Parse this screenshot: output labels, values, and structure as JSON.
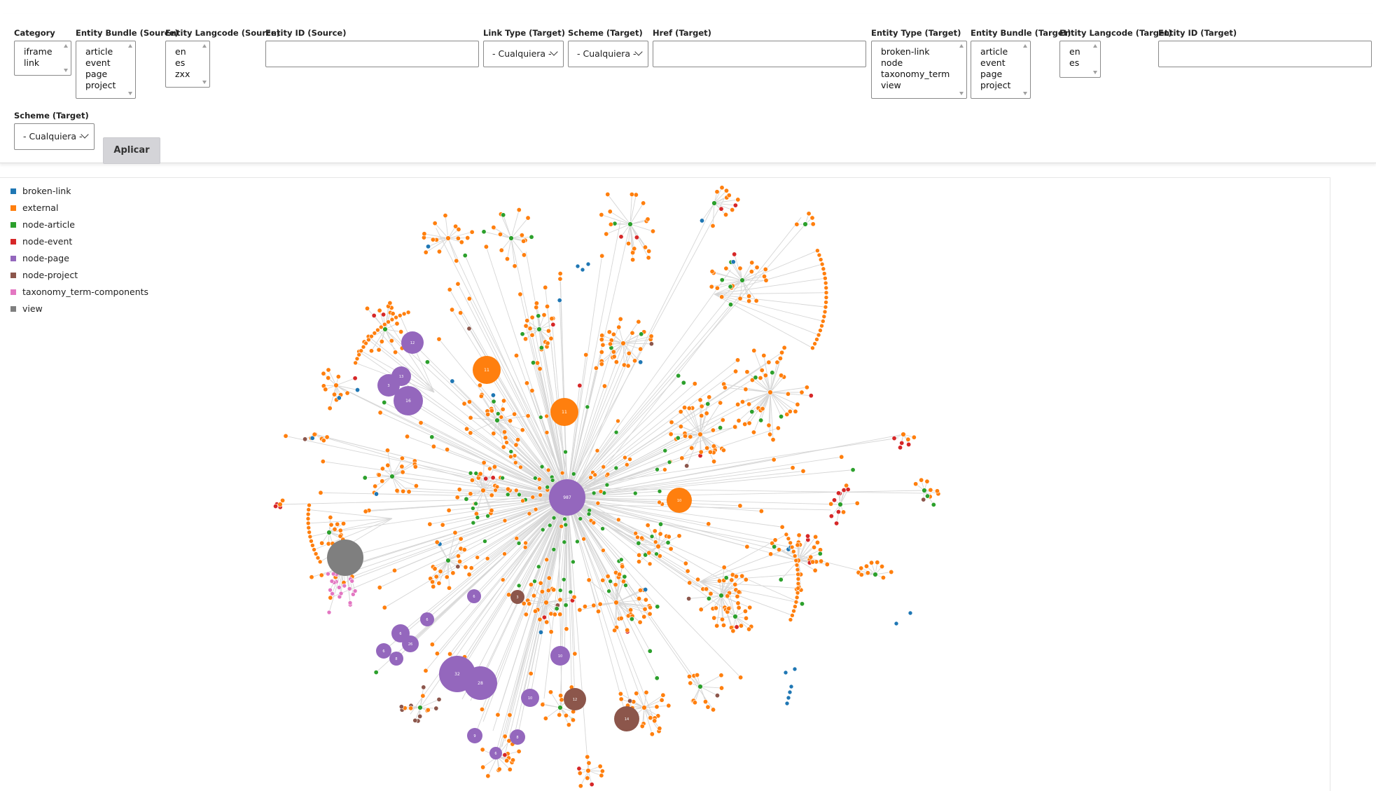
{
  "filters": {
    "category": {
      "label": "Category",
      "options": [
        "iframe",
        "link"
      ]
    },
    "entity_bundle_source": {
      "label": "Entity Bundle (Source)",
      "options": [
        "article",
        "event",
        "page",
        "project"
      ]
    },
    "entity_langcode_source": {
      "label": "Entity Langcode (Source)",
      "options": [
        "en",
        "es",
        "zxx"
      ]
    },
    "entity_id_source": {
      "label": "Entity ID (Source)",
      "value": ""
    },
    "link_type_target": {
      "label": "Link Type (Target)",
      "value": "- Cualquiera -"
    },
    "scheme_target": {
      "label": "Scheme (Target)",
      "value": "- Cualquiera -"
    },
    "href_target": {
      "label": "Href (Target)",
      "value": ""
    },
    "entity_type_target": {
      "label": "Entity Type (Target)",
      "options": [
        "broken-link",
        "node",
        "taxonomy_term",
        "view"
      ]
    },
    "entity_bundle_target": {
      "label": "Entity Bundle (Target)",
      "options": [
        "article",
        "event",
        "page",
        "project"
      ]
    },
    "entity_langcode_target": {
      "label": "Entity Langcode (Target)",
      "options": [
        "en",
        "es"
      ]
    },
    "entity_id_target": {
      "label": "Entity ID (Target)",
      "value": ""
    },
    "scheme_target_2": {
      "label": "Scheme (Target)",
      "value": "- Cualquiera -"
    },
    "apply_label": "Aplicar"
  },
  "legend": [
    {
      "label": "broken-link",
      "color": "#1f77b4"
    },
    {
      "label": "external",
      "color": "#ff7f0e"
    },
    {
      "label": "node-article",
      "color": "#2ca02c"
    },
    {
      "label": "node-event",
      "color": "#d62728"
    },
    {
      "label": "node-page",
      "color": "#9467bd"
    },
    {
      "label": "node-project",
      "color": "#8c564b"
    },
    {
      "label": "taxonomy_term-components",
      "color": "#e377c2"
    },
    {
      "label": "view",
      "color": "#7f7f7f"
    }
  ],
  "graph": {
    "edge_color": "#d6d6d6",
    "hubs": [
      {
        "group": "node-page",
        "label": "987"
      },
      {
        "group": "external",
        "label": "11"
      },
      {
        "group": "external",
        "label": "11"
      },
      {
        "group": "external",
        "label": "10"
      },
      {
        "group": "node-page",
        "label": "12"
      },
      {
        "group": "node-page",
        "label": "13"
      },
      {
        "group": "node-page",
        "label": "16"
      },
      {
        "group": "node-page",
        "label": "3"
      },
      {
        "group": "view",
        "label": ""
      },
      {
        "group": "node-page",
        "label": "32"
      },
      {
        "group": "node-page",
        "label": "28"
      },
      {
        "group": "node-page",
        "label": "10"
      },
      {
        "group": "node-page",
        "label": "6"
      },
      {
        "group": "node-page",
        "label": "26"
      },
      {
        "group": "node-page",
        "label": "6"
      },
      {
        "group": "node-page",
        "label": "8"
      },
      {
        "group": "node-project",
        "label": "12"
      },
      {
        "group": "node-project",
        "label": "14"
      },
      {
        "group": "node-project",
        "label": "3"
      },
      {
        "group": "node-page",
        "label": "10"
      },
      {
        "group": "node-page",
        "label": "9"
      },
      {
        "group": "node-page",
        "label": "8"
      },
      {
        "group": "node-page",
        "label": "6"
      },
      {
        "group": "node-page",
        "label": "6"
      },
      {
        "group": "node-page",
        "label": "6"
      }
    ]
  }
}
